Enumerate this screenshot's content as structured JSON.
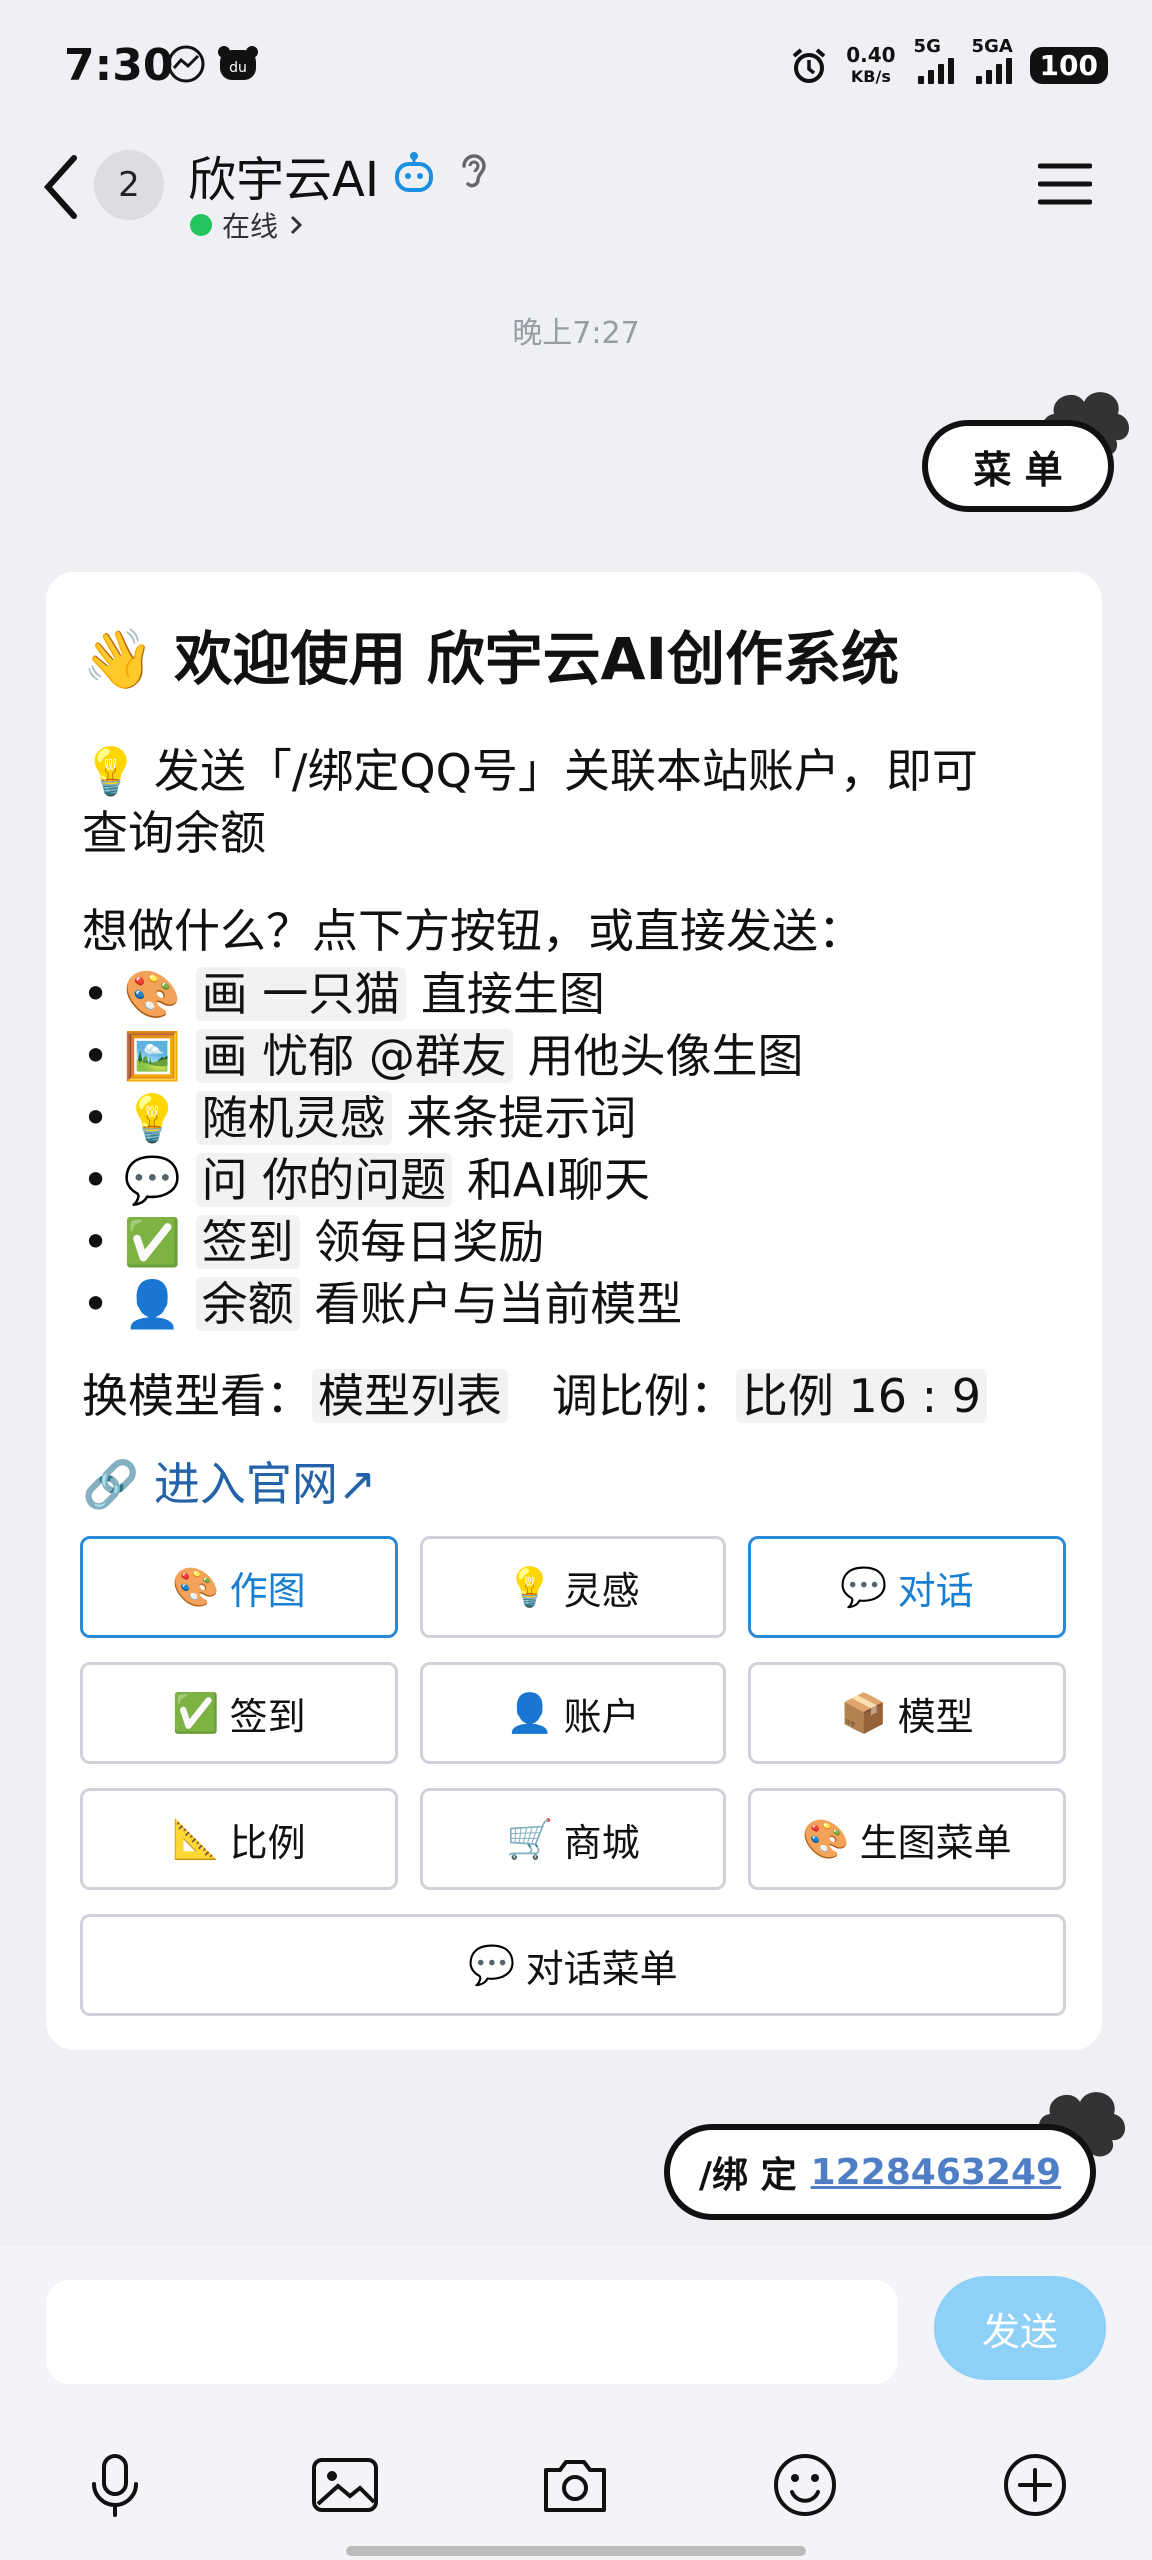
{
  "status": {
    "time": "7:30",
    "speed_value": "0.40",
    "speed_unit": "KB/s",
    "sig1": "5G",
    "sig2": "5GA",
    "battery": "100"
  },
  "header": {
    "back_count": "2",
    "title": "欣宇云AI",
    "online": "在线",
    "icons": [
      "chevron-left-icon",
      "robot-icon",
      "hearing-icon",
      "menu-icon"
    ]
  },
  "chat": {
    "timestamp": "晚上7:27",
    "sticker_menu": "菜 单",
    "card": {
      "title_emoji": "👋",
      "title": "欢迎使用 欣宇云AI创作系统",
      "bind_emoji": "💡",
      "bind_line1": "发送「/绑定QQ号」关联本站账户，即可",
      "bind_line2": "查询余额",
      "prompt": "想做什么？点下方按钮，或直接发送：",
      "items": [
        {
          "emoji": "🎨",
          "cmd": "画  一只猫",
          "desc": "直接生图"
        },
        {
          "emoji": "🖼️",
          "cmd": "画  忧郁  @群友",
          "desc": "用他头像生图"
        },
        {
          "emoji": "💡",
          "cmd": "随机灵感",
          "desc": "来条提示词"
        },
        {
          "emoji": "💬",
          "cmd": "问  你的问题",
          "desc": "和AI聊天"
        },
        {
          "emoji": "✅",
          "cmd": "签到",
          "desc": "领每日奖励"
        },
        {
          "emoji": "👤",
          "cmd": "余额",
          "desc": "看账户与当前模型"
        }
      ],
      "model_label": "换模型看：",
      "model_cmd": "模型列表",
      "ratio_label": "调比例：",
      "ratio_cmd": "比例 16 : 9",
      "link_emoji": "🔗",
      "link": "进入官网↗",
      "buttons": [
        {
          "emoji": "🎨",
          "label": "作图"
        },
        {
          "emoji": "💡",
          "label": "灵感"
        },
        {
          "emoji": "💬",
          "label": "对话"
        },
        {
          "emoji": "✅",
          "label": "签到"
        },
        {
          "emoji": "👤",
          "label": "账户"
        },
        {
          "emoji": "📦",
          "label": "模型"
        },
        {
          "emoji": "📐",
          "label": "比例"
        },
        {
          "emoji": "🛒",
          "label": "商城"
        },
        {
          "emoji": "🎨",
          "label": "生图菜单"
        },
        {
          "emoji": "💬",
          "label": "对话菜单"
        }
      ]
    },
    "sticker_bind_prefix": "/绑 定",
    "sticker_bind_number": "1228463249"
  },
  "input": {
    "send": "发送",
    "tools": [
      "microphone-icon",
      "image-icon",
      "camera-icon",
      "emoji-icon",
      "plus-icon"
    ]
  }
}
